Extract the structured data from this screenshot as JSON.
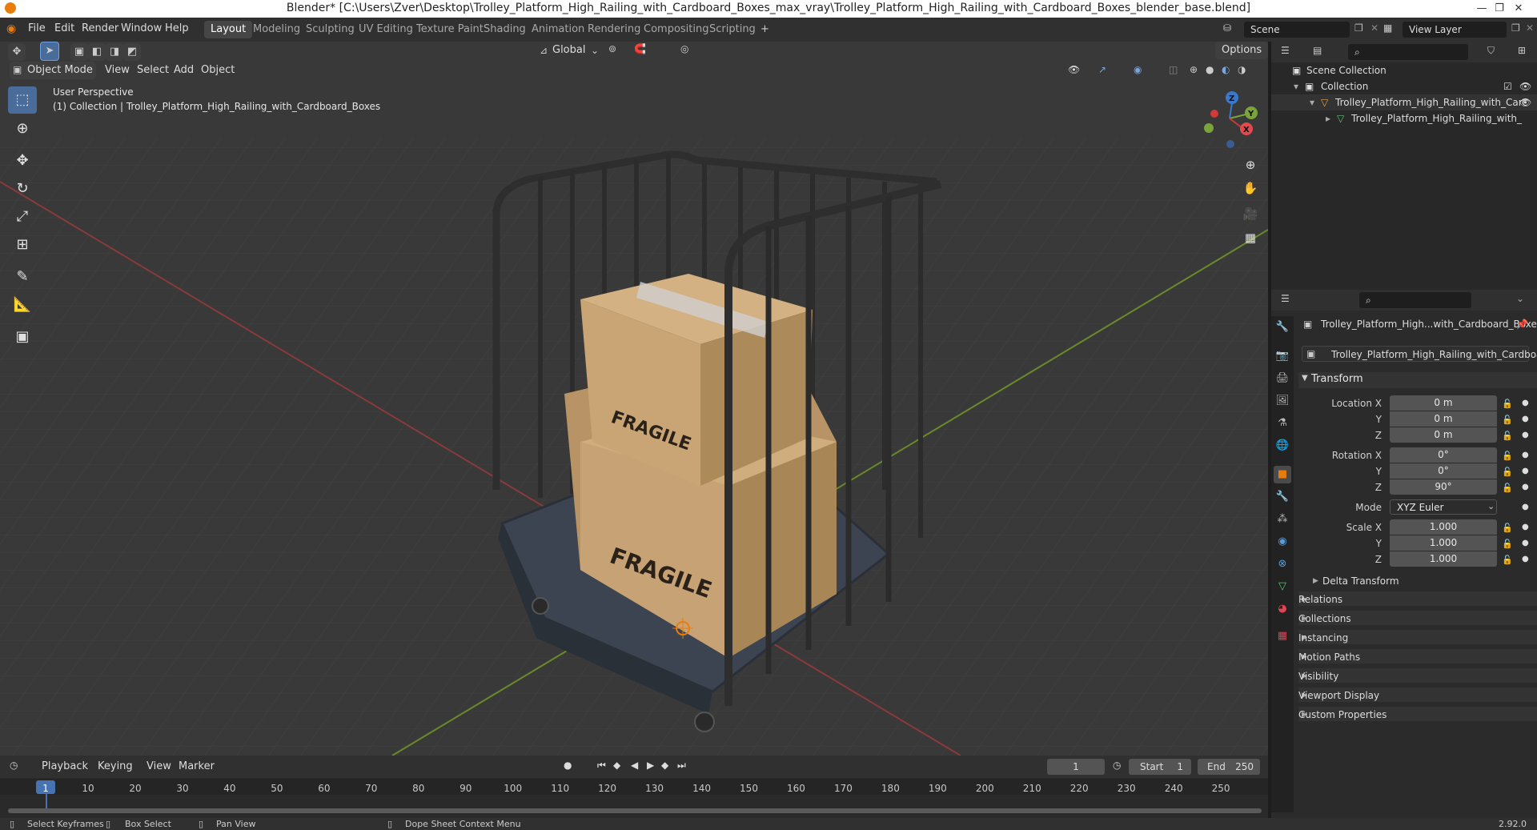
{
  "window": {
    "title": "Blender* [C:\\Users\\Zver\\Desktop\\Trolley_Platform_High_Railing_with_Cardboard_Boxes_max_vray\\Trolley_Platform_High_Railing_with_Cardboard_Boxes_blender_base.blend]",
    "controls": [
      "—",
      "❐",
      "✕"
    ]
  },
  "menubar": {
    "items": [
      "File",
      "Edit",
      "Render",
      "Window",
      "Help"
    ],
    "workspaces": [
      "Layout",
      "Modeling",
      "Sculpting",
      "UV Editing",
      "Texture Paint",
      "Shading",
      "Animation",
      "Rendering",
      "Compositing",
      "Scripting"
    ],
    "add_tab": "+",
    "scene": "Scene",
    "view_layer": "View Layer"
  },
  "viewport": {
    "mode": "Object Mode",
    "menus": [
      "View",
      "Select",
      "Add",
      "Object"
    ],
    "transform_orientation": "Global",
    "options_label": "Options",
    "perspective": "User Perspective",
    "collection_info": "(1) Collection | Trolley_Platform_High_Railing_with_Cardboard_Boxes",
    "box_label": "FRAGILE",
    "gizmo_axes": [
      "X",
      "Y",
      "Z"
    ]
  },
  "outliner": {
    "root": "Scene Collection",
    "collection": "Collection",
    "object": "Trolley_Platform_High_Railing_with_Carc",
    "mesh": "Trolley_Platform_High_Railing_with_"
  },
  "properties": {
    "object_name": "Trolley_Platform_High...with_Cardboard_Boxe",
    "data_name": "Trolley_Platform_High_Railing_with_Cardboard_...",
    "transform_title": "Transform",
    "location": {
      "label_x": "Location X",
      "x": "0 m",
      "y": "0 m",
      "z": "0 m"
    },
    "rotation": {
      "label_x": "Rotation X",
      "x": "0°",
      "y": "0°",
      "z": "90°"
    },
    "mode_label": "Mode",
    "mode_value": "XYZ Euler",
    "scale": {
      "label_x": "Scale X",
      "x": "1.000",
      "y": "1.000",
      "z": "1.000"
    },
    "axis_y": "Y",
    "axis_z": "Z",
    "delta": "Delta Transform",
    "panels": [
      "Relations",
      "Collections",
      "Instancing",
      "Motion Paths",
      "Visibility",
      "Viewport Display",
      "Custom Properties"
    ]
  },
  "timeline": {
    "menus": [
      "Playback",
      "Keying",
      "View",
      "Marker"
    ],
    "current_frame": "1",
    "start_label": "Start",
    "start": "1",
    "end_label": "End",
    "end": "250",
    "ticks": [
      "1",
      "10",
      "20",
      "30",
      "40",
      "50",
      "60",
      "70",
      "80",
      "90",
      "100",
      "110",
      "120",
      "130",
      "140",
      "150",
      "160",
      "170",
      "180",
      "190",
      "200",
      "210",
      "220",
      "230",
      "240",
      "250"
    ]
  },
  "statusbar": {
    "items": [
      "Select Keyframes",
      "Box Select",
      "Pan View",
      "Dope Sheet Context Menu"
    ],
    "version": "2.92.0"
  },
  "colors": {
    "accent": "#4772b3",
    "orange": "#e87d0d",
    "bg": "#3a3a3a"
  }
}
